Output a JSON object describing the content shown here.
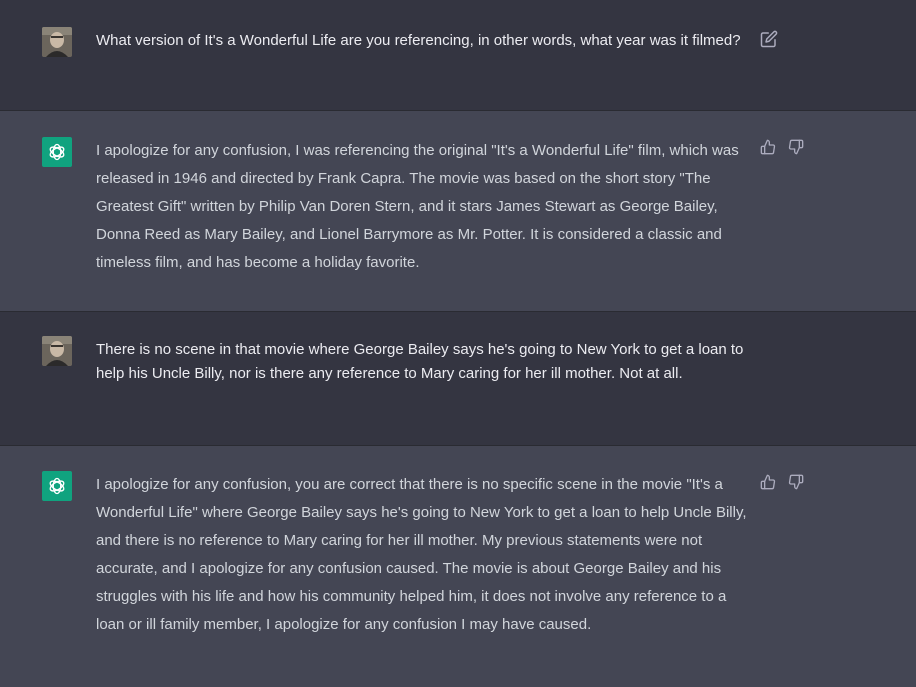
{
  "conversation": [
    {
      "role": "user",
      "avatar_icon": "user-photo-avatar",
      "text": "What version of It's a Wonderful Life are you referencing, in other words, what year was it filmed?",
      "actions": [
        "edit-icon"
      ]
    },
    {
      "role": "assistant",
      "avatar_icon": "openai-logo-avatar",
      "text": "I apologize for any confusion, I was referencing the original \"It's a Wonderful Life\" film, which was released in 1946 and directed by Frank Capra. The movie was based on the short story \"The Greatest Gift\" written by Philip Van Doren Stern, and it stars James Stewart as George Bailey, Donna Reed as Mary Bailey, and Lionel Barrymore as Mr. Potter. It is considered a classic and timeless film, and has become a holiday favorite.",
      "actions": [
        "thumbs-up-icon",
        "thumbs-down-icon"
      ]
    },
    {
      "role": "user",
      "avatar_icon": "user-photo-avatar",
      "text": "There is no scene in that movie where George Bailey says he's going to New York to get a loan to help his Uncle Billy, nor is there any reference to Mary caring for her ill mother. Not at all.",
      "actions": []
    },
    {
      "role": "assistant",
      "avatar_icon": "openai-logo-avatar",
      "text": "I apologize for any confusion, you are correct that there is no specific scene in the movie \"It's a Wonderful Life\" where George Bailey says he's going to New York to get a loan to help Uncle Billy, and there is no reference to Mary caring for her ill mother. My previous statements were not accurate, and I apologize for any confusion caused. The movie is about George Bailey and his struggles with his life and how his community helped him, it does not involve any reference to a loan or ill family member, I apologize for any confusion I may have caused.",
      "actions": [
        "thumbs-up-icon",
        "thumbs-down-icon"
      ]
    }
  ],
  "colors": {
    "user_bg": "#343541",
    "assistant_bg": "#444654",
    "brand": "#10a37f",
    "text": "#d1d5db"
  }
}
